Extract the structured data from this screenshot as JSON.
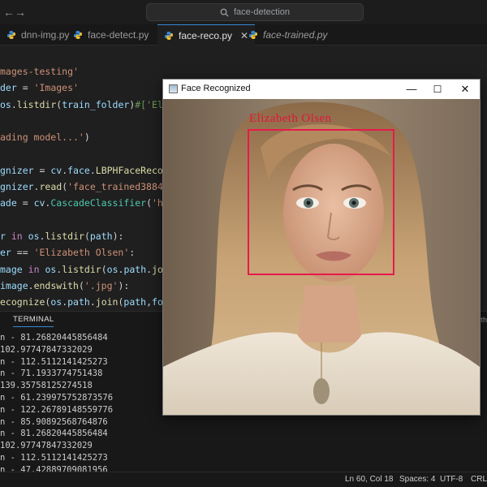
{
  "titlebar": {
    "search_text": "face-detection"
  },
  "tabs": [
    {
      "label": "dnn-img.py"
    },
    {
      "label": "face-detect.py"
    },
    {
      "label": "face-reco.py"
    },
    {
      "label": "face-trained.py"
    }
  ],
  "editor": {
    "lines": [
      {
        "tokens": [
          {
            "t": "str",
            "v": "mages-testing'"
          }
        ]
      },
      {
        "tokens": [
          {
            "t": "var",
            "v": "der"
          },
          {
            "t": "plain",
            "v": " = "
          },
          {
            "t": "str",
            "v": "'Images'"
          }
        ]
      },
      {
        "tokens": [
          {
            "t": "var",
            "v": "os"
          },
          {
            "t": "plain",
            "v": "."
          },
          {
            "t": "fn",
            "v": "listdir"
          },
          {
            "t": "plain",
            "v": "("
          },
          {
            "t": "var",
            "v": "train_folder"
          },
          {
            "t": "plain",
            "v": ")"
          },
          {
            "t": "com",
            "v": "#['Elizabe"
          }
        ]
      },
      {
        "tokens": []
      },
      {
        "tokens": [
          {
            "t": "str",
            "v": "ading model...'"
          },
          {
            "t": "plain",
            "v": ")"
          }
        ]
      },
      {
        "tokens": []
      },
      {
        "tokens": [
          {
            "t": "var",
            "v": "gnizer"
          },
          {
            "t": "plain",
            "v": " = "
          },
          {
            "t": "var",
            "v": "cv"
          },
          {
            "t": "plain",
            "v": "."
          },
          {
            "t": "var",
            "v": "face"
          },
          {
            "t": "plain",
            "v": "."
          },
          {
            "t": "fn",
            "v": "LBPHFaceRecognize"
          }
        ]
      },
      {
        "tokens": [
          {
            "t": "var",
            "v": "gnizer"
          },
          {
            "t": "plain",
            "v": "."
          },
          {
            "t": "fn",
            "v": "read"
          },
          {
            "t": "plain",
            "v": "("
          },
          {
            "t": "str",
            "v": "'face_trained3884.yml'"
          }
        ]
      },
      {
        "tokens": [
          {
            "t": "var",
            "v": "ade"
          },
          {
            "t": "plain",
            "v": " = "
          },
          {
            "t": "var",
            "v": "cv"
          },
          {
            "t": "plain",
            "v": "."
          },
          {
            "t": "cls",
            "v": "CascadeClassifier"
          },
          {
            "t": "plain",
            "v": "("
          },
          {
            "t": "str",
            "v": "'haarca"
          }
        ]
      },
      {
        "tokens": []
      },
      {
        "tokens": [
          {
            "t": "var",
            "v": "r"
          },
          {
            "t": "plain",
            "v": " "
          },
          {
            "t": "kw",
            "v": "in"
          },
          {
            "t": "plain",
            "v": " "
          },
          {
            "t": "var",
            "v": "os"
          },
          {
            "t": "plain",
            "v": "."
          },
          {
            "t": "fn",
            "v": "listdir"
          },
          {
            "t": "plain",
            "v": "("
          },
          {
            "t": "var",
            "v": "path"
          },
          {
            "t": "plain",
            "v": "):"
          }
        ]
      },
      {
        "tokens": [
          {
            "t": "var",
            "v": "er"
          },
          {
            "t": "plain",
            "v": " == "
          },
          {
            "t": "str",
            "v": "'Elizabeth Olsen'"
          },
          {
            "t": "plain",
            "v": ":"
          }
        ]
      },
      {
        "tokens": [
          {
            "t": "var",
            "v": "mage"
          },
          {
            "t": "plain",
            "v": " "
          },
          {
            "t": "kw",
            "v": "in"
          },
          {
            "t": "plain",
            "v": " "
          },
          {
            "t": "var",
            "v": "os"
          },
          {
            "t": "plain",
            "v": "."
          },
          {
            "t": "fn",
            "v": "listdir"
          },
          {
            "t": "plain",
            "v": "("
          },
          {
            "t": "var",
            "v": "os"
          },
          {
            "t": "plain",
            "v": "."
          },
          {
            "t": "var",
            "v": "path"
          },
          {
            "t": "plain",
            "v": "."
          },
          {
            "t": "fn",
            "v": "join"
          },
          {
            "t": "plain",
            "v": "(pa"
          }
        ]
      },
      {
        "tokens": [
          {
            "t": "var",
            "v": "image"
          },
          {
            "t": "plain",
            "v": "."
          },
          {
            "t": "fn",
            "v": "endswith"
          },
          {
            "t": "plain",
            "v": "("
          },
          {
            "t": "str",
            "v": "'.jpg'"
          },
          {
            "t": "plain",
            "v": "):"
          }
        ]
      },
      {
        "tokens": [
          {
            "t": "fn",
            "v": "ecognize"
          },
          {
            "t": "plain",
            "v": "("
          },
          {
            "t": "var",
            "v": "os"
          },
          {
            "t": "plain",
            "v": "."
          },
          {
            "t": "var",
            "v": "path"
          },
          {
            "t": "plain",
            "v": "."
          },
          {
            "t": "fn",
            "v": "join"
          },
          {
            "t": "plain",
            "v": "("
          },
          {
            "t": "var",
            "v": "path"
          },
          {
            "t": "plain",
            "v": ","
          },
          {
            "t": "var",
            "v": "folder"
          },
          {
            "t": "plain",
            "v": ","
          }
        ]
      },
      {
        "tokens": [
          {
            "t": "plain",
            "v": "("
          },
          {
            "t": "var",
            "v": "folder"
          },
          {
            "t": "plain",
            "v": ")"
          }
        ]
      }
    ]
  },
  "panel": {
    "tab_label": "TERMINAL",
    "right_text": "yth",
    "lines": [
      "n - 81.26820445856484",
      "102.97747847332029",
      "n - 112.5112141425273",
      "n - 71.1933774751438",
      "139.35758125274518",
      "n - 61.239975752873576",
      "n - 122.26789148559776",
      "n - 85.90892568764876",
      "n - 81.26820445856484",
      "102.97747847332029",
      "n - 112.5112141425273",
      "n - 47.42889709081956"
    ]
  },
  "statusbar": {
    "position": "Ln 60, Col 18",
    "spaces": "Spaces: 4",
    "encoding": "UTF-8",
    "eol": "CRLF"
  },
  "cv_window": {
    "title": "Face Recognized",
    "minimize_glyph": "—",
    "maximize_glyph": "☐",
    "close_glyph": "✕",
    "detection_label": "Elizabeth Olsen",
    "box_color": "#e8194a",
    "label_color": "#e0163a"
  },
  "colors": {
    "accent": "#3a86d4",
    "editor_bg": "#1f1f1f",
    "string": "#ce9178",
    "variable": "#9cdcfe",
    "function": "#dcdcaa",
    "keyword": "#c586c0",
    "class": "#4ec9b0"
  },
  "icons": {
    "back": "arrow-left-icon",
    "forward": "arrow-right-icon",
    "search": "search-icon",
    "python": "python-file-icon",
    "close": "close-icon"
  }
}
